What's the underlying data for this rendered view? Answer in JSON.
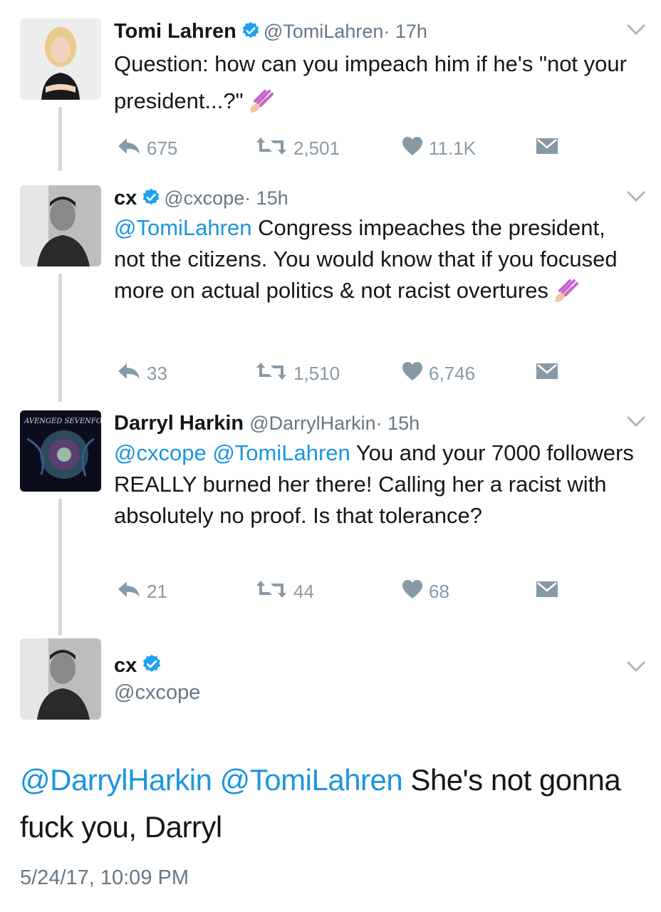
{
  "tweets": [
    {
      "name": "Tomi Lahren",
      "handle": "@TomiLahren",
      "time": "· 17h",
      "text_parts": [
        {
          "t": "Question: how can you impeach him if he's \"not your president...?\"",
          "mention": false
        }
      ],
      "emoji": "nail-polish",
      "replies": "675",
      "retweets": "2,501",
      "likes": "11.1K"
    },
    {
      "name": "cx",
      "handle": "@cxcope",
      "time": "· 15h",
      "text_parts": [
        {
          "t": "@TomiLahren",
          "mention": true
        },
        {
          "t": " Congress impeaches the president, not the citizens. You would know that if you focused more on actual politics & not racist overtures",
          "mention": false
        }
      ],
      "emoji": "nail-polish",
      "replies": "33",
      "retweets": "1,510",
      "likes": "6,746"
    },
    {
      "name": "Darryl Harkin",
      "handle": "@DarrylHarkin",
      "time": "· 15h",
      "avatar_text": "AVENGED SEVENFOLD",
      "text_parts": [
        {
          "t": "@cxcope",
          "mention": true
        },
        {
          "t": " ",
          "mention": false
        },
        {
          "t": "@TomiLahren",
          "mention": true
        },
        {
          "t": " You and your 7000 followers REALLY burned her there! Calling her a racist with absolutely no proof. Is that tolerance?",
          "mention": false
        }
      ],
      "replies": "21",
      "retweets": "44",
      "likes": "68"
    }
  ],
  "focus": {
    "name": "cx",
    "handle": "@cxcope",
    "mention1": "@DarrylHarkin",
    "mention2": "@TomiLahren",
    "text": " She's not gonna fuck you, Darryl",
    "timestamp": "5/24/17, 10:09 PM"
  },
  "colors": {
    "mention": "#1b95e0",
    "verified": "#1da1f2",
    "muted": "#8899a6",
    "thread": "#cfd9de"
  },
  "icons": [
    "reply-icon",
    "retweet-icon",
    "like-icon",
    "dm-icon",
    "verified-badge-icon",
    "chevron-down-icon",
    "nail-polish-emoji"
  ]
}
